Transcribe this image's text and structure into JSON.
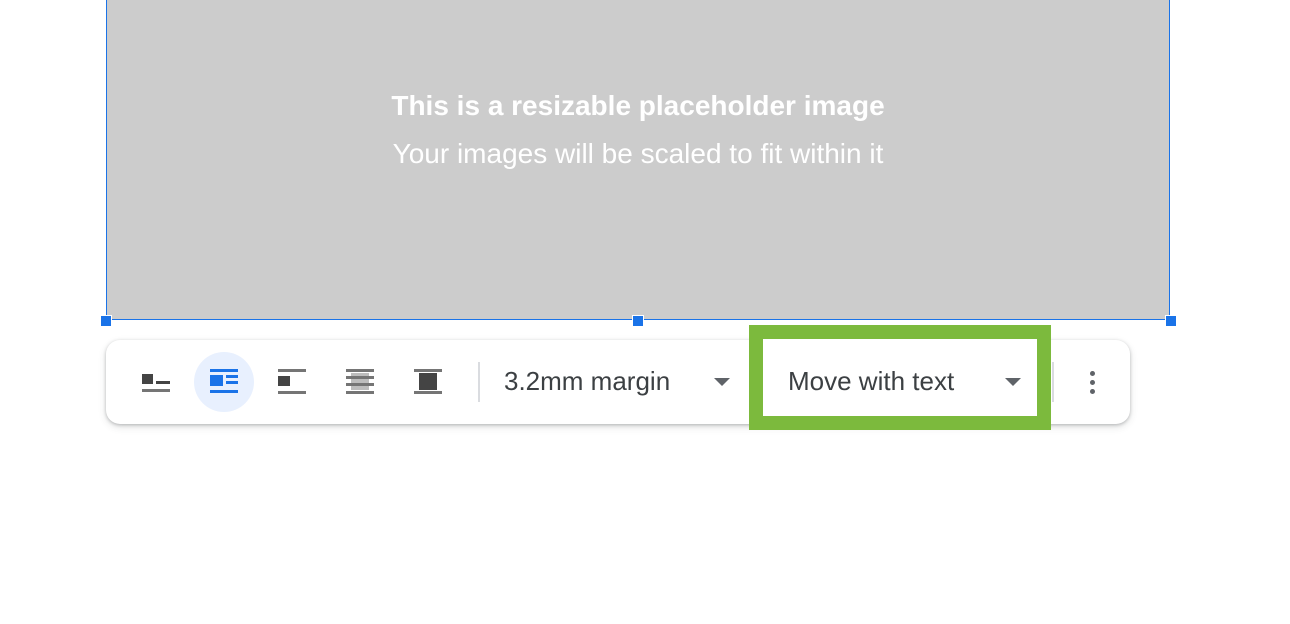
{
  "placeholder": {
    "title": "This is a resizable placeholder image",
    "subtitle": "Your images will be scaled to fit within it"
  },
  "toolbar": {
    "wrap_options": [
      {
        "icon": "inline-icon",
        "active": false
      },
      {
        "icon": "wrap-text-icon",
        "active": true
      },
      {
        "icon": "break-text-icon",
        "active": false
      },
      {
        "icon": "behind-text-icon",
        "active": false
      },
      {
        "icon": "in-front-of-text-icon",
        "active": false
      }
    ],
    "margin_label": "3.2mm margin",
    "position_label": "Move with text",
    "more_icon": "more-vert-icon"
  },
  "colors": {
    "accent": "#1a73e8",
    "active_bg": "#e8f0fe",
    "highlight": "#7cba3d",
    "placeholder_bg": "#cccccc"
  }
}
